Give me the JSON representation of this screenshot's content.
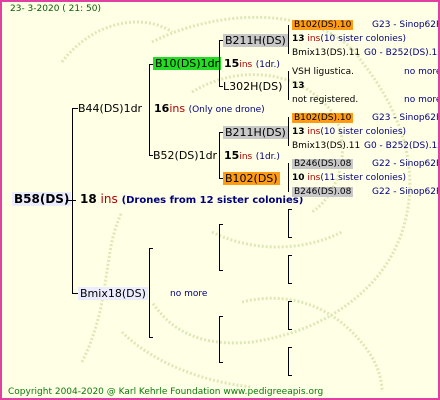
{
  "header": {
    "date": "23-  3-2020 ( 21: 50)"
  },
  "footer": {
    "copyright": "Copyright 2004-2020 @ Karl Kehrle Foundation    www.pedigreeapis.org"
  },
  "colors": {
    "border": "#e040a0",
    "background": "#ffffe6",
    "ins": "#b00000",
    "note": "#000080",
    "green": "#22dd22",
    "orange": "#ff9a14",
    "gray": "#c8c8c8"
  },
  "root": {
    "name": "B58(DS)",
    "ins_num": "18",
    "ins_label": "ins",
    "note": "(Drones from 12 sister colonies)"
  },
  "gen1": {
    "b44": {
      "name": "B44(DS)1dr",
      "ins_num": "16",
      "ins_label": "ins",
      "note": "(Only one drone)"
    },
    "bmix": {
      "name": "Bmix18(DS)",
      "note": "no more"
    }
  },
  "gen2": {
    "b10": {
      "name": "B10(DS)1dr",
      "ins_num": "15",
      "ins_label": "ins",
      "note": "(1dr.)"
    },
    "b52": {
      "name": "B52(DS)1dr",
      "ins_num": "15",
      "ins_label": "ins",
      "note": "(1dr.)"
    }
  },
  "gen3": {
    "b211_a": {
      "name": "B211H(DS)"
    },
    "l302": {
      "name": "L302H(DS)"
    },
    "b211_b": {
      "name": "B211H(DS)"
    },
    "b102": {
      "name": "B102(DS)"
    }
  },
  "gen4": {
    "r1": {
      "name": "B102(DS).10",
      "info": "G23 - Sinop62R"
    },
    "r2": {
      "num": "13",
      "ins_label": "ins",
      "note": "(10 sister colonies)"
    },
    "r3": {
      "name": "Bmix13(DS).11",
      "info": "G0 - B252(DS).1x"
    },
    "r4": {
      "name": "VSH ligustica.",
      "info": "no more"
    },
    "r5": {
      "num": "13"
    },
    "r6": {
      "name": "not registered.",
      "info": "no more"
    },
    "r7": {
      "name": "B102(DS).10",
      "info": "G23 - Sinop62R"
    },
    "r8": {
      "num": "13",
      "ins_label": "ins",
      "note": "(10 sister colonies)"
    },
    "r9": {
      "name": "Bmix13(DS).11",
      "info": "G0 - B252(DS).1x"
    },
    "r10": {
      "name": "B246(DS).08",
      "info": "G22 - Sinop62R"
    },
    "r11": {
      "num": "10",
      "ins_label": "ins",
      "note": "(11 sister colonies)"
    },
    "r12": {
      "name": "B246(DS).08",
      "info": "G22 - Sinop62R"
    }
  }
}
